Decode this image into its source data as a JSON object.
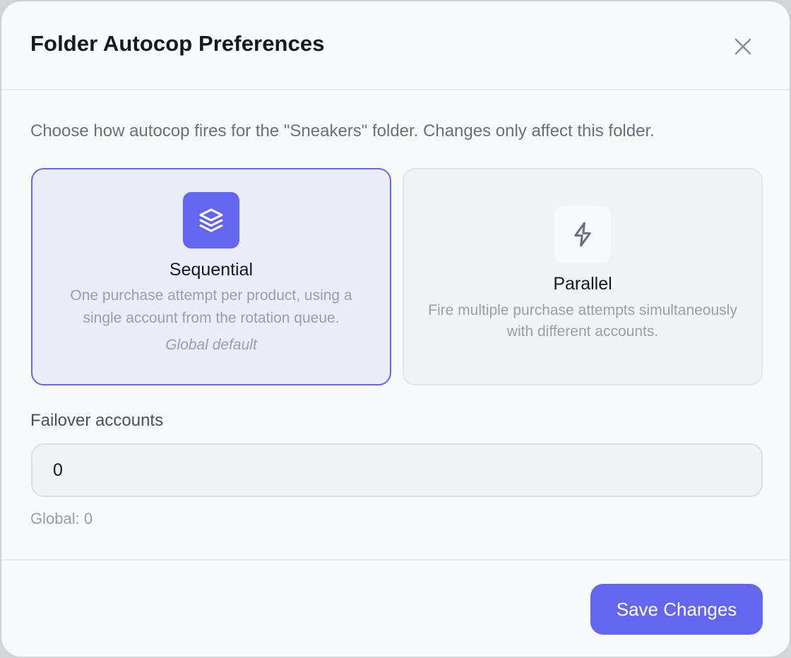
{
  "dialog": {
    "title": "Folder Autocop Preferences",
    "description": "Choose how autocop fires for the \"Sneakers\" folder. Changes only affect this folder."
  },
  "modes": [
    {
      "title": "Sequential",
      "description": "One purchase attempt per product, using a single account from the rotation queue.",
      "note": "Global default",
      "icon": "layers-icon",
      "selected": true
    },
    {
      "title": "Parallel",
      "description": "Fire multiple purchase attempts simultaneously with different accounts.",
      "icon": "lightning-icon",
      "selected": false
    }
  ],
  "failover": {
    "label": "Failover accounts",
    "value": "0",
    "hint": "Global: 0"
  },
  "footer": {
    "save_label": "Save Changes"
  },
  "colors": {
    "accent": "#6366f1",
    "selected_bg": "#eaecf8"
  }
}
